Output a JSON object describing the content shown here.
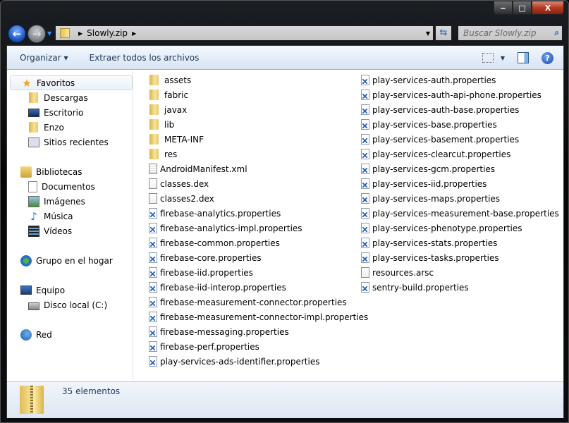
{
  "window": {
    "minimize": "‒",
    "maximize": "□",
    "close": "X"
  },
  "address": {
    "path": "Slowly.zip",
    "search_placeholder": "Buscar Slowly.zip"
  },
  "toolbar": {
    "organize": "Organizar ▾",
    "extract": "Extraer todos los archivos",
    "help": "?"
  },
  "nav": [
    {
      "label": "Favoritos",
      "icon": "star",
      "sel": true
    },
    {
      "label": "Descargas",
      "icon": "folder",
      "indent": true
    },
    {
      "label": "Escritorio",
      "icon": "desk",
      "indent": true
    },
    {
      "label": "Enzo",
      "icon": "folder",
      "indent": true
    },
    {
      "label": "Sitios recientes",
      "icon": "recent",
      "indent": true
    },
    {
      "label": "Bibliotecas",
      "icon": "lib",
      "gap": true
    },
    {
      "label": "Documentos",
      "icon": "doc",
      "indent": true
    },
    {
      "label": "Imágenes",
      "icon": "pic",
      "indent": true
    },
    {
      "label": "Música",
      "icon": "music",
      "indent": true
    },
    {
      "label": "Vídeos",
      "icon": "video",
      "indent": true
    },
    {
      "label": "Grupo en el hogar",
      "icon": "home",
      "gap": true
    },
    {
      "label": "Equipo",
      "icon": "pc",
      "gap": true
    },
    {
      "label": "Disco local (C:)",
      "icon": "disk",
      "indent": true
    },
    {
      "label": "Red",
      "icon": "net",
      "gap": true
    }
  ],
  "files_col1": [
    {
      "name": "assets",
      "type": "folder"
    },
    {
      "name": "fabric",
      "type": "folder"
    },
    {
      "name": "javax",
      "type": "folder"
    },
    {
      "name": "lib",
      "type": "folder"
    },
    {
      "name": "META-INF",
      "type": "folder"
    },
    {
      "name": "res",
      "type": "folder"
    },
    {
      "name": "AndroidManifest.xml",
      "type": "xml"
    },
    {
      "name": "classes.dex",
      "type": "blank"
    },
    {
      "name": "classes2.dex",
      "type": "blank"
    },
    {
      "name": "firebase-analytics.properties",
      "type": "props"
    },
    {
      "name": "firebase-analytics-impl.properties",
      "type": "props"
    },
    {
      "name": "firebase-common.properties",
      "type": "props"
    },
    {
      "name": "firebase-core.properties",
      "type": "props"
    },
    {
      "name": "firebase-iid.properties",
      "type": "props"
    },
    {
      "name": "firebase-iid-interop.properties",
      "type": "props"
    },
    {
      "name": "firebase-measurement-connector.properties",
      "type": "props"
    },
    {
      "name": "firebase-measurement-connector-impl.properties",
      "type": "props"
    },
    {
      "name": "firebase-messaging.properties",
      "type": "props"
    },
    {
      "name": "firebase-perf.properties",
      "type": "props"
    },
    {
      "name": "play-services-ads-identifier.properties",
      "type": "props"
    }
  ],
  "files_col2": [
    {
      "name": "play-services-auth.properties",
      "type": "props"
    },
    {
      "name": "play-services-auth-api-phone.properties",
      "type": "props"
    },
    {
      "name": "play-services-auth-base.properties",
      "type": "props"
    },
    {
      "name": "play-services-base.properties",
      "type": "props"
    },
    {
      "name": "play-services-basement.properties",
      "type": "props"
    },
    {
      "name": "play-services-clearcut.properties",
      "type": "props"
    },
    {
      "name": "play-services-gcm.properties",
      "type": "props"
    },
    {
      "name": "play-services-iid.properties",
      "type": "props"
    },
    {
      "name": "play-services-maps.properties",
      "type": "props"
    },
    {
      "name": "play-services-measurement-base.properties",
      "type": "props"
    },
    {
      "name": "play-services-phenotype.properties",
      "type": "props"
    },
    {
      "name": "play-services-stats.properties",
      "type": "props"
    },
    {
      "name": "play-services-tasks.properties",
      "type": "props"
    },
    {
      "name": "resources.arsc",
      "type": "blank"
    },
    {
      "name": "sentry-build.properties",
      "type": "props"
    }
  ],
  "status": {
    "count": "35 elementos"
  }
}
